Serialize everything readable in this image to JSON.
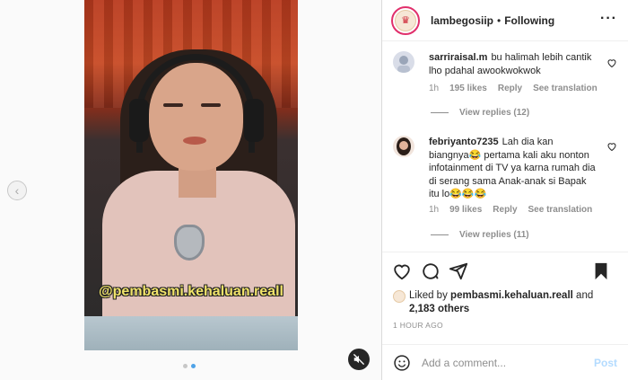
{
  "media": {
    "watermark": "@pembasmi.kehaluan.reall",
    "prev_icon": "chevron-left-icon",
    "mute_icon": "speaker-muted-icon",
    "carousel_dots": 2,
    "carousel_active": 2
  },
  "header": {
    "username": "lambegosiip",
    "separator": "•",
    "follow_status": "Following",
    "more_icon": "ellipsis-icon"
  },
  "comments": [
    {
      "username": "sarriraisal.m",
      "text": "bu halimah lebih cantik lho pdahal awookwokwok",
      "time": "1h",
      "likes": "195 likes",
      "reply": "Reply",
      "translate": "See translation",
      "view_replies": "View replies (12)"
    },
    {
      "username": "febriyanto7235",
      "text": "Lah dia kan biangnya😂 pertama kali aku nonton infotainment di TV ya karna rumah dia di serang sama Anak-anak si Bapak itu lo😂😂😂",
      "time": "1h",
      "likes": "99 likes",
      "reply": "Reply",
      "translate": "See translation",
      "view_replies": "View replies (11)"
    }
  ],
  "actions": {
    "like_icon": "heart-icon",
    "comment_icon": "comment-icon",
    "share_icon": "send-icon",
    "save_icon": "bookmark-icon"
  },
  "likes": {
    "prefix": "Liked by",
    "user": "pembasmi.kehaluan.reall",
    "conjunction": "and",
    "others": "2,183 others"
  },
  "time_ago": "1 HOUR AGO",
  "comment_box": {
    "placeholder": "Add a comment...",
    "post_label": "Post",
    "emoji_icon": "smiley-icon"
  },
  "colors": {
    "text": "#262626",
    "muted": "#8e8e8e",
    "post_disabled": "#b3dbff",
    "story_ring": "#e1306c",
    "watermark": "#f0e36a",
    "carousel_active": "#4fa3e8"
  }
}
